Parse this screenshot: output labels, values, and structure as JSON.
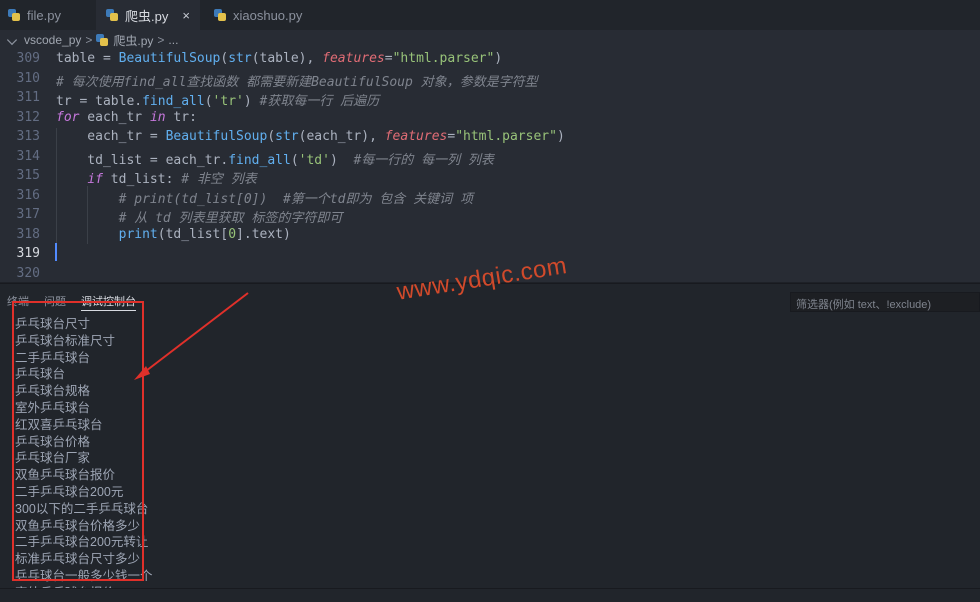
{
  "tabs": [
    {
      "label": "file.py",
      "active": false
    },
    {
      "label": "爬虫.py",
      "active": true,
      "close": "×"
    },
    {
      "label": "xiaoshuo.py",
      "active": false
    }
  ],
  "breadcrumb": {
    "folder": "vscode_py",
    "sep": ">",
    "file": "爬虫.py",
    "sep2": ">",
    "more": "..."
  },
  "editor": {
    "line_numbers": [
      "309",
      "310",
      "311",
      "312",
      "313",
      "314",
      "315",
      "316",
      "317",
      "318",
      "319",
      "320"
    ],
    "current_line": "319",
    "lines": [
      [
        {
          "t": "table = ",
          "c": ""
        },
        {
          "t": "BeautifulSoup",
          "c": "fn"
        },
        {
          "t": "(",
          "c": ""
        },
        {
          "t": "str",
          "c": "fn"
        },
        {
          "t": "(table), ",
          "c": ""
        },
        {
          "t": "features",
          "c": "param"
        },
        {
          "t": "=",
          "c": ""
        },
        {
          "t": "\"html.parser\"",
          "c": "str"
        },
        {
          "t": ")",
          "c": ""
        }
      ],
      [
        {
          "t": "# 每次使用find_all查找函数 都需要新建BeautifulSoup 对象，参数是字符型",
          "c": "cmt"
        }
      ],
      [
        {
          "t": "tr = table.",
          "c": ""
        },
        {
          "t": "find_all",
          "c": "fn"
        },
        {
          "t": "(",
          "c": ""
        },
        {
          "t": "'tr'",
          "c": "str"
        },
        {
          "t": ") ",
          "c": ""
        },
        {
          "t": "#获取每一行 后遍历",
          "c": "cmt"
        }
      ],
      [
        {
          "t": "for",
          "c": "kw"
        },
        {
          "t": " each_tr ",
          "c": ""
        },
        {
          "t": "in",
          "c": "kw"
        },
        {
          "t": " tr:",
          "c": ""
        }
      ],
      [
        {
          "t": "    each_tr = ",
          "c": ""
        },
        {
          "t": "BeautifulSoup",
          "c": "fn"
        },
        {
          "t": "(",
          "c": ""
        },
        {
          "t": "str",
          "c": "fn"
        },
        {
          "t": "(each_tr), ",
          "c": ""
        },
        {
          "t": "features",
          "c": "param"
        },
        {
          "t": "=",
          "c": ""
        },
        {
          "t": "\"html.parser\"",
          "c": "str"
        },
        {
          "t": ")",
          "c": ""
        }
      ],
      [
        {
          "t": "    td_list = each_tr.",
          "c": ""
        },
        {
          "t": "find_all",
          "c": "fn"
        },
        {
          "t": "(",
          "c": ""
        },
        {
          "t": "'td'",
          "c": "str"
        },
        {
          "t": ")  ",
          "c": ""
        },
        {
          "t": "#每一行的 每一列 列表",
          "c": "cmt"
        }
      ],
      [
        {
          "t": "    ",
          "c": ""
        },
        {
          "t": "if",
          "c": "kw"
        },
        {
          "t": " td_list: ",
          "c": ""
        },
        {
          "t": "# 非空 列表",
          "c": "cmt"
        }
      ],
      [
        {
          "t": "        ",
          "c": ""
        },
        {
          "t": "# print(td_list[0])  #第一个td即为 包含 关键词 项",
          "c": "cmt"
        }
      ],
      [
        {
          "t": "        ",
          "c": ""
        },
        {
          "t": "# 从 td 列表里获取 标签的字符即可",
          "c": "cmt"
        }
      ],
      [
        {
          "t": "        ",
          "c": ""
        },
        {
          "t": "print",
          "c": "fn"
        },
        {
          "t": "(td_list[",
          "c": ""
        },
        {
          "t": "0",
          "c": "str"
        },
        {
          "t": "].text)",
          "c": ""
        }
      ],
      [],
      []
    ]
  },
  "panel": {
    "tabs": [
      "终端",
      "问题",
      "调试控制台"
    ],
    "active_tab": "调试控制台",
    "filter_placeholder": "筛选器(例如 text、!exclude)",
    "output": [
      "乒乓球台尺寸",
      "乒乓球台标准尺寸",
      "二手乒乓球台",
      "乒乓球台",
      "乒乓球台规格",
      "室外乒乓球台",
      "红双喜乒乓球台",
      "乒乓球台价格",
      "乒乓球台厂家",
      "双鱼乒乓球台报价",
      "二手乒乓球台200元",
      "300以下的二手乒乓球台",
      "双鱼乒乓球台价格多少",
      "二手乒乓球台200元转让",
      "标准乒乓球台尺寸多少",
      "乒乓球台一般多少钱一个",
      "室外乒乓球台报价"
    ]
  },
  "watermark": "www.ydqic.com",
  "colors": {
    "annotation": "#e0302a",
    "watermark": "#d14a2b",
    "editor_bg": "#282c34",
    "panel_bg": "#21252b"
  }
}
